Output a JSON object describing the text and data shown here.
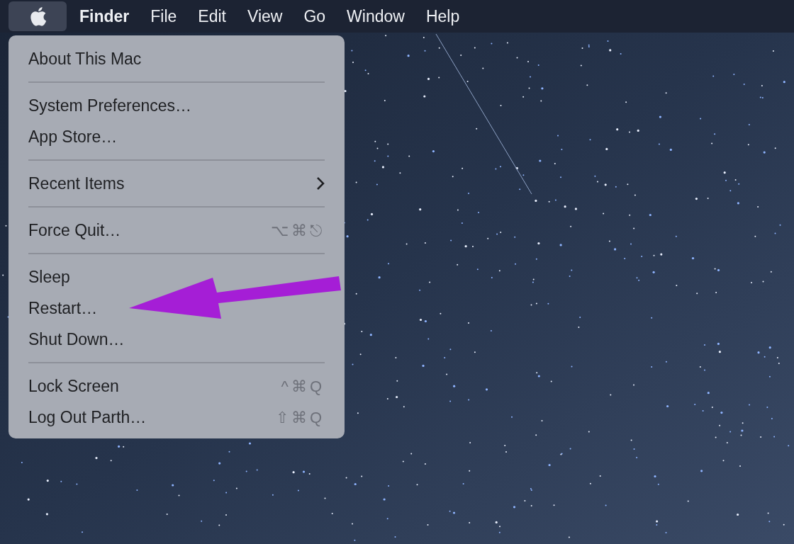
{
  "menu_bar": {
    "apple_selected": true,
    "items": [
      {
        "label": "Finder",
        "bold": true
      },
      {
        "label": "File",
        "bold": false
      },
      {
        "label": "Edit",
        "bold": false
      },
      {
        "label": "View",
        "bold": false
      },
      {
        "label": "Go",
        "bold": false
      },
      {
        "label": "Window",
        "bold": false
      },
      {
        "label": "Help",
        "bold": false
      }
    ]
  },
  "apple_menu": {
    "sections": [
      [
        {
          "label": "About This Mac",
          "submenu": false
        }
      ],
      [
        {
          "label": "System Preferences…",
          "submenu": false
        },
        {
          "label": "App Store…",
          "submenu": false
        }
      ],
      [
        {
          "label": "Recent Items",
          "submenu": true
        }
      ],
      [
        {
          "label": "Force Quit…",
          "submenu": false,
          "shortcut": "⌥⌘⎋"
        }
      ],
      [
        {
          "label": "Sleep",
          "submenu": false
        },
        {
          "label": "Restart…",
          "submenu": false
        },
        {
          "label": "Shut Down…",
          "submenu": false
        }
      ],
      [
        {
          "label": "Lock Screen",
          "submenu": false,
          "shortcut": "^⌘Q"
        },
        {
          "label": "Log Out Parth…",
          "submenu": false,
          "shortcut": "⇧⌘Q"
        }
      ]
    ]
  }
}
